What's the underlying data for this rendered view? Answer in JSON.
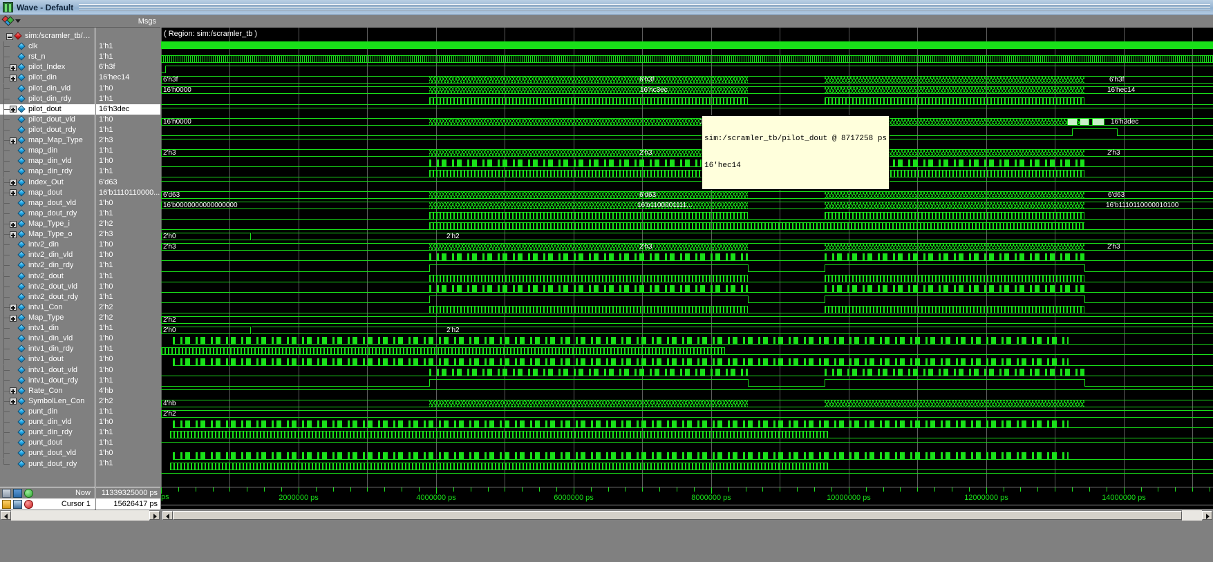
{
  "window": {
    "title": "Wave - Default",
    "icon": "wave-window-icon"
  },
  "columns": {
    "msgs_header": "Msgs"
  },
  "region_label": "( Region: sim:/scramler_tb )",
  "signals": [
    {
      "name": "sim:/scramler_tb/Gr...",
      "value": "",
      "expander": "minus",
      "icon": "red-diamond-icon",
      "depth": 0,
      "selected": false,
      "wave": "none"
    },
    {
      "name": "clk",
      "value": "1'h1",
      "expander": "none",
      "icon": "signal-icon",
      "depth": 1,
      "selected": false,
      "wave": "fastclk"
    },
    {
      "name": "rst_n",
      "value": "1'h1",
      "expander": "none",
      "icon": "signal-icon",
      "depth": 1,
      "selected": false,
      "wave": "rst"
    },
    {
      "name": "pilot_Index",
      "value": "6'h3f",
      "expander": "plus",
      "icon": "signal-icon",
      "depth": 1,
      "selected": false,
      "wave": "bus",
      "bus": "6'h3f"
    },
    {
      "name": "pilot_din",
      "value": "16'hec14",
      "expander": "plus",
      "icon": "signal-icon",
      "depth": 1,
      "selected": false,
      "wave": "bus",
      "bus": "16'h0000"
    },
    {
      "name": "pilot_din_vld",
      "value": "1'h0",
      "expander": "none",
      "icon": "signal-icon",
      "depth": 1,
      "selected": false,
      "wave": "burst"
    },
    {
      "name": "pilot_din_rdy",
      "value": "1'h1",
      "expander": "none",
      "icon": "signal-icon",
      "depth": 1,
      "selected": false,
      "wave": "high"
    },
    {
      "name": "pilot_dout",
      "value": "16'h3dec",
      "expander": "plus",
      "icon": "signal-icon",
      "depth": 1,
      "selected": true,
      "wave": "bus",
      "bus": "16'h0000"
    },
    {
      "name": "pilot_dout_vld",
      "value": "1'h0",
      "expander": "none",
      "icon": "signal-icon",
      "depth": 1,
      "selected": false,
      "wave": "pulse"
    },
    {
      "name": "pilot_dout_rdy",
      "value": "1'h1",
      "expander": "none",
      "icon": "signal-icon",
      "depth": 1,
      "selected": false,
      "wave": "high"
    },
    {
      "name": "map_Map_Type",
      "value": "2'h3",
      "expander": "plus",
      "icon": "signal-icon",
      "depth": 1,
      "selected": false,
      "wave": "bus",
      "bus": "2'h3"
    },
    {
      "name": "map_din",
      "value": "1'h1",
      "expander": "none",
      "icon": "signal-icon",
      "depth": 1,
      "selected": false,
      "wave": "rand"
    },
    {
      "name": "map_din_vld",
      "value": "1'h0",
      "expander": "none",
      "icon": "signal-icon",
      "depth": 1,
      "selected": false,
      "wave": "burst"
    },
    {
      "name": "map_din_rdy",
      "value": "1'h1",
      "expander": "none",
      "icon": "signal-icon",
      "depth": 1,
      "selected": false,
      "wave": "high"
    },
    {
      "name": "Index_Out",
      "value": "6'd63",
      "expander": "plus",
      "icon": "signal-icon",
      "depth": 1,
      "selected": false,
      "wave": "bus",
      "bus": "6'd63"
    },
    {
      "name": "map_dout",
      "value": "16'b1110110000...",
      "expander": "plus",
      "icon": "signal-icon",
      "depth": 1,
      "selected": false,
      "wave": "bus",
      "bus": "16'b0000000000000000"
    },
    {
      "name": "map_dout_vld",
      "value": "1'h0",
      "expander": "none",
      "icon": "signal-icon",
      "depth": 1,
      "selected": false,
      "wave": "burst"
    },
    {
      "name": "map_dout_rdy",
      "value": "1'h1",
      "expander": "none",
      "icon": "signal-icon",
      "depth": 1,
      "selected": false,
      "wave": "burst2"
    },
    {
      "name": "Map_Type_i",
      "value": "2'h2",
      "expander": "plus",
      "icon": "signal-icon",
      "depth": 1,
      "selected": false,
      "wave": "bus2",
      "bus": "2'h0",
      "bus2": "2'h2"
    },
    {
      "name": "Map_Type_o",
      "value": "2'h3",
      "expander": "plus",
      "icon": "signal-icon",
      "depth": 1,
      "selected": false,
      "wave": "bus",
      "bus": "2'h3"
    },
    {
      "name": "intv2_din",
      "value": "1'h0",
      "expander": "none",
      "icon": "signal-icon",
      "depth": 1,
      "selected": false,
      "wave": "rand"
    },
    {
      "name": "intv2_din_vld",
      "value": "1'h0",
      "expander": "none",
      "icon": "signal-icon",
      "depth": 1,
      "selected": false,
      "wave": "blk"
    },
    {
      "name": "intv2_din_rdy",
      "value": "1'h1",
      "expander": "none",
      "icon": "signal-icon",
      "depth": 1,
      "selected": false,
      "wave": "burst"
    },
    {
      "name": "intv2_dout",
      "value": "1'h1",
      "expander": "none",
      "icon": "signal-icon",
      "depth": 1,
      "selected": false,
      "wave": "rand"
    },
    {
      "name": "intv2_dout_vld",
      "value": "1'h0",
      "expander": "none",
      "icon": "signal-icon",
      "depth": 1,
      "selected": false,
      "wave": "blk"
    },
    {
      "name": "intv2_dout_rdy",
      "value": "1'h1",
      "expander": "none",
      "icon": "signal-icon",
      "depth": 1,
      "selected": false,
      "wave": "burst"
    },
    {
      "name": "intv1_Con",
      "value": "2'h2",
      "expander": "plus",
      "icon": "signal-icon",
      "depth": 1,
      "selected": false,
      "wave": "bus3",
      "bus": "2'h2"
    },
    {
      "name": "Map_Type",
      "value": "2'h2",
      "expander": "plus",
      "icon": "signal-icon",
      "depth": 1,
      "selected": false,
      "wave": "bus2",
      "bus": "2'h0",
      "bus2": "2'h2"
    },
    {
      "name": "intv1_din",
      "value": "1'h1",
      "expander": "none",
      "icon": "signal-icon",
      "depth": 1,
      "selected": false,
      "wave": "randwide"
    },
    {
      "name": "intv1_din_vld",
      "value": "1'h0",
      "expander": "none",
      "icon": "signal-icon",
      "depth": 1,
      "selected": false,
      "wave": "burstleft"
    },
    {
      "name": "intv1_din_rdy",
      "value": "1'h1",
      "expander": "none",
      "icon": "signal-icon",
      "depth": 1,
      "selected": false,
      "wave": "randwide2"
    },
    {
      "name": "intv1_dout",
      "value": "1'h0",
      "expander": "none",
      "icon": "signal-icon",
      "depth": 1,
      "selected": false,
      "wave": "randmid"
    },
    {
      "name": "intv1_dout_vld",
      "value": "1'h0",
      "expander": "none",
      "icon": "signal-icon",
      "depth": 1,
      "selected": false,
      "wave": "blk"
    },
    {
      "name": "intv1_dout_rdy",
      "value": "1'h1",
      "expander": "none",
      "icon": "signal-icon",
      "depth": 1,
      "selected": false,
      "wave": "high"
    },
    {
      "name": "Rate_Con",
      "value": "4'hb",
      "expander": "plus",
      "icon": "signal-icon",
      "depth": 1,
      "selected": false,
      "wave": "bus",
      "bus": "4'hb"
    },
    {
      "name": "SymbolLen_Con",
      "value": "2'h2",
      "expander": "plus",
      "icon": "signal-icon",
      "depth": 1,
      "selected": false,
      "wave": "bus3",
      "bus": "2'h2"
    },
    {
      "name": "punt_din",
      "value": "1'h1",
      "expander": "none",
      "icon": "signal-icon",
      "depth": 1,
      "selected": false,
      "wave": "randwide"
    },
    {
      "name": "punt_din_vld",
      "value": "1'h0",
      "expander": "none",
      "icon": "signal-icon",
      "depth": 1,
      "selected": false,
      "wave": "burstleft2"
    },
    {
      "name": "punt_din_rdy",
      "value": "1'h1",
      "expander": "none",
      "icon": "signal-icon",
      "depth": 1,
      "selected": false,
      "wave": "none"
    },
    {
      "name": "punt_dout",
      "value": "1'h1",
      "expander": "none",
      "icon": "signal-icon",
      "depth": 1,
      "selected": false,
      "wave": "randwide"
    },
    {
      "name": "punt_dout_vld",
      "value": "1'h0",
      "expander": "none",
      "icon": "signal-icon",
      "depth": 1,
      "selected": false,
      "wave": "burstleft2"
    },
    {
      "name": "punt_dout_rdy",
      "value": "1'h1",
      "expander": "none",
      "icon": "signal-icon",
      "depth": 1,
      "selected": false,
      "wave": "none"
    }
  ],
  "wave_labels": {
    "pilot_Index": [
      {
        "t": 0,
        "text": "6'h3f"
      },
      {
        "t": 6930,
        "text": "6'h3f"
      },
      {
        "t": 13760,
        "text": "6'h3f"
      }
    ],
    "pilot_din": [
      {
        "t": 0,
        "text": "16'h0000"
      },
      {
        "t": 6940,
        "text": "16'hc3ec"
      },
      {
        "t": 13730,
        "text": "16'hec14"
      }
    ],
    "pilot_dout": [
      {
        "t": 0,
        "text": "16'h0000"
      },
      {
        "t": 7800,
        "text": "16'hec14"
      },
      {
        "t": 13780,
        "text": "16'h3dec"
      }
    ],
    "map_Map_Type": [
      {
        "t": 0,
        "text": "2'h3"
      },
      {
        "t": 6930,
        "text": "2'h3"
      },
      {
        "t": 13730,
        "text": "2'h3"
      }
    ],
    "Index_Out": [
      {
        "t": 0,
        "text": "6'd63"
      },
      {
        "t": 6930,
        "text": "6'd63"
      },
      {
        "t": 13740,
        "text": "6'd63"
      }
    ],
    "map_dout": [
      {
        "t": 0,
        "text": "16'b0000000000000000"
      },
      {
        "t": 6900,
        "text": "16'b1100001111..."
      },
      {
        "t": 13710,
        "text": "16'b1110110000010100"
      }
    ],
    "Map_Type_i": [
      {
        "t": 0,
        "text": "2'h0"
      },
      {
        "t": 4120,
        "text": "2'h2"
      }
    ],
    "Map_Type_o": [
      {
        "t": 0,
        "text": "2'h3"
      },
      {
        "t": 6930,
        "text": "2'h3"
      },
      {
        "t": 13730,
        "text": "2'h3"
      }
    ],
    "intv1_Con": [
      {
        "t": 0,
        "text": "2'h2"
      }
    ],
    "Map_Type": [
      {
        "t": 0,
        "text": "2'h0"
      },
      {
        "t": 4120,
        "text": "2'h2"
      }
    ],
    "Rate_Con": [
      {
        "t": 0,
        "text": "4'hb"
      }
    ],
    "SymbolLen_Con": [
      {
        "t": 0,
        "text": "2'h2"
      }
    ]
  },
  "tooltip": {
    "line1": "sim:/scramler_tb/pilot_dout @ 8717258 ps",
    "line2": "16'hec14"
  },
  "time_axis": {
    "unit": "ps",
    "origin_label": "ps",
    "ticks": [
      {
        "value": 2000000,
        "label": "2000000 ps"
      },
      {
        "value": 4000000,
        "label": "4000000 ps"
      },
      {
        "value": 6000000,
        "label": "6000000 ps"
      },
      {
        "value": 8000000,
        "label": "8000000 ps"
      },
      {
        "value": 10000000,
        "label": "10000000 ps"
      },
      {
        "value": 12000000,
        "label": "12000000 ps"
      },
      {
        "value": 14000000,
        "label": "14000000 ps"
      }
    ],
    "min": 0,
    "max": 15300000
  },
  "status": {
    "now_label": "Now",
    "now_value": "11339325000 ps",
    "cursor_label": "Cursor 1",
    "cursor_value": "15626417 ps"
  },
  "colors": {
    "wave_green": "#19e019",
    "background": "#000000",
    "panel": "#808080",
    "selection": "#ffffff",
    "tooltip_bg": "#ffffdc"
  }
}
